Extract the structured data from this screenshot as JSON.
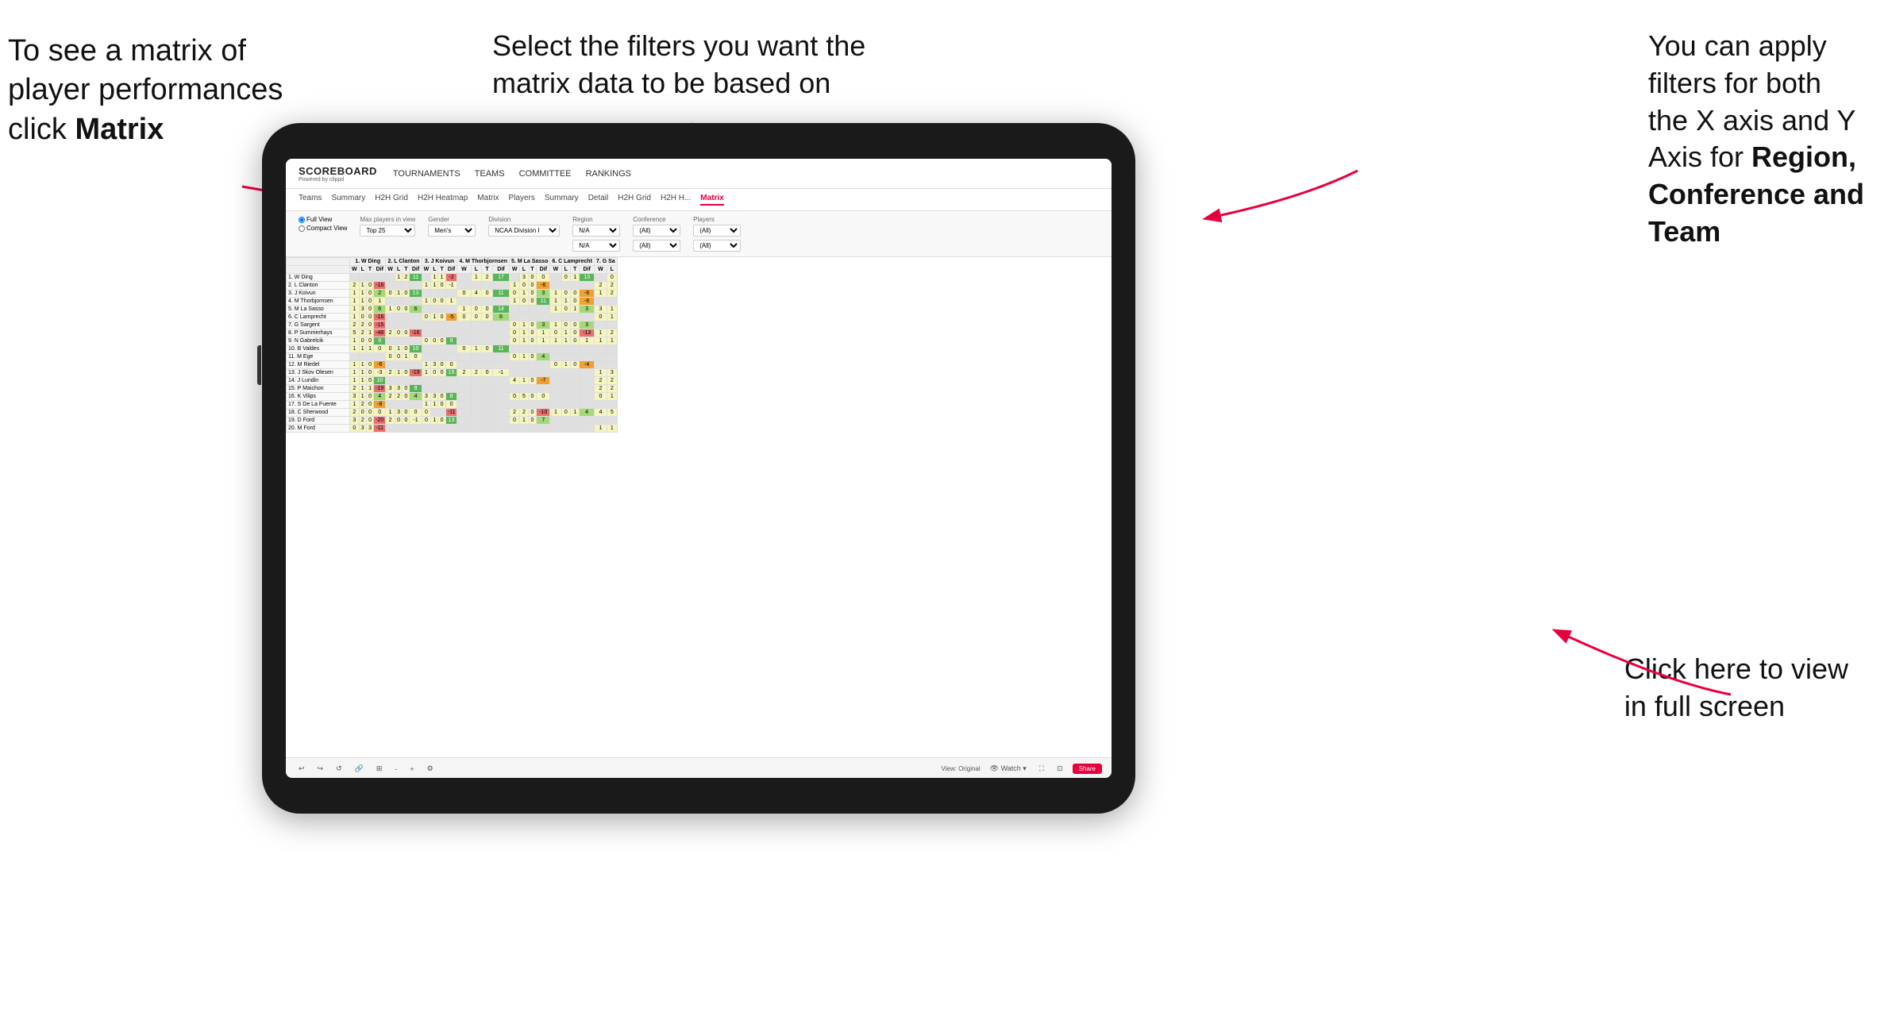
{
  "annotations": {
    "top_left": {
      "line1": "To see a matrix of",
      "line2": "player performances",
      "line3_prefix": "click ",
      "line3_bold": "Matrix"
    },
    "top_center": {
      "line1": "Select the filters you want the",
      "line2": "matrix data to be based on"
    },
    "top_right": {
      "line1": "You  can apply",
      "line2": "filters for both",
      "line3": "the X axis and Y",
      "line4_prefix": "Axis for ",
      "line4_bold": "Region,",
      "line5_bold": "Conference and",
      "line6_bold": "Team"
    },
    "bottom_right": {
      "line1": "Click here to view",
      "line2": "in full screen"
    }
  },
  "nav": {
    "logo": "SCOREBOARD",
    "logo_sub": "Powered by clippd",
    "links": [
      "TOURNAMENTS",
      "TEAMS",
      "COMMITTEE",
      "RANKINGS"
    ]
  },
  "tabs": {
    "items": [
      "Teams",
      "Summary",
      "H2H Grid",
      "H2H Heatmap",
      "Matrix",
      "Players",
      "Summary",
      "Detail",
      "H2H Grid",
      "H2H H...",
      "Matrix"
    ],
    "active": "Matrix"
  },
  "filters": {
    "view_options": [
      "Full View",
      "Compact View"
    ],
    "max_players": "Top 25",
    "gender": "Men's",
    "division": "NCAA Division I",
    "region_label": "Region",
    "region_val": "N/A",
    "conference_label": "Conference",
    "conference_val": "(All)",
    "players_label": "Players",
    "players_val": "(All)"
  },
  "matrix": {
    "col_groups": [
      "1. W Ding",
      "2. L Clanton",
      "3. J Koivun",
      "4. M Thorbjornsen",
      "5. M La Sasso",
      "6. C Lamprecht",
      "7. G Sa"
    ],
    "col_subheaders": [
      "W",
      "L",
      "T",
      "Dif"
    ],
    "rows": [
      {
        "name": "1. W Ding",
        "cells": [
          {
            "type": "gray"
          },
          {
            "val": "1",
            "cls": "yellow"
          },
          {
            "val": "2",
            "cls": "yellow"
          },
          {
            "val": "0",
            "cls": "yellow"
          },
          {
            "val": "11",
            "cls": "green-mid"
          }
        ]
      },
      {
        "name": "2. L Clanton",
        "cells": [
          {
            "val": "2",
            "cls": "green-light"
          },
          {
            "val": "1",
            "cls": "yellow"
          },
          {
            "val": "0",
            "cls": "yellow"
          },
          {
            "val": "-16",
            "cls": "red"
          }
        ]
      },
      {
        "name": "3. J Koivun",
        "cells": [
          {
            "val": "1",
            "cls": "yellow"
          },
          {
            "val": "1",
            "cls": "yellow"
          },
          {
            "val": "0",
            "cls": "yellow"
          },
          {
            "val": "2",
            "cls": "green-light"
          }
        ]
      },
      {
        "name": "4. M Thorbjornsen",
        "cells": [
          {
            "val": "1",
            "cls": "yellow"
          },
          {
            "val": "1",
            "cls": "yellow"
          },
          {
            "val": "0",
            "cls": "yellow"
          },
          {
            "val": "1",
            "cls": "yellow"
          }
        ]
      },
      {
        "name": "5. M La Sasso",
        "cells": [
          {
            "val": "1",
            "cls": "yellow"
          },
          {
            "val": "3",
            "cls": "green-light"
          },
          {
            "val": "0",
            "cls": "yellow"
          },
          {
            "val": "6",
            "cls": "green-light"
          }
        ]
      },
      {
        "name": "6. C Lamprecht",
        "cells": [
          {
            "val": "1",
            "cls": "yellow"
          },
          {
            "val": "0",
            "cls": "yellow"
          },
          {
            "val": "0",
            "cls": "yellow"
          },
          {
            "val": "-16",
            "cls": "red"
          }
        ]
      },
      {
        "name": "7. G Sargent",
        "cells": [
          {
            "val": "2",
            "cls": "green-light"
          },
          {
            "val": "2",
            "cls": "green-light"
          },
          {
            "val": "0",
            "cls": "yellow"
          },
          {
            "val": "-15",
            "cls": "red"
          }
        ]
      },
      {
        "name": "8. P Summerhays",
        "cells": [
          {
            "val": "5",
            "cls": "green-dark"
          },
          {
            "val": "2",
            "cls": "green-light"
          },
          {
            "val": "1",
            "cls": "yellow"
          },
          {
            "val": "-48",
            "cls": "red"
          }
        ]
      },
      {
        "name": "9. N Gabrelcik",
        "cells": [
          {
            "val": "1",
            "cls": "yellow"
          },
          {
            "val": "0",
            "cls": "yellow"
          },
          {
            "val": "0",
            "cls": "yellow"
          },
          {
            "val": "9",
            "cls": "green-mid"
          }
        ]
      },
      {
        "name": "10. B Valdes",
        "cells": [
          {
            "val": "1",
            "cls": "yellow"
          },
          {
            "val": "1",
            "cls": "yellow"
          },
          {
            "val": "1",
            "cls": "yellow"
          },
          {
            "val": "0",
            "cls": "yellow"
          }
        ]
      },
      {
        "name": "11. M Ege",
        "cells": [
          {
            "val": "0",
            "cls": "yellow"
          },
          {
            "val": "0",
            "cls": "yellow"
          },
          {
            "val": "1",
            "cls": "yellow"
          },
          {
            "val": "0",
            "cls": "yellow"
          }
        ]
      },
      {
        "name": "12. M Riedel",
        "cells": [
          {
            "val": "1",
            "cls": "yellow"
          },
          {
            "val": "1",
            "cls": "yellow"
          },
          {
            "val": "0",
            "cls": "yellow"
          },
          {
            "val": "-6",
            "cls": "orange"
          }
        ]
      },
      {
        "name": "13. J Skov Olesen",
        "cells": [
          {
            "val": "1",
            "cls": "yellow"
          },
          {
            "val": "1",
            "cls": "yellow"
          },
          {
            "val": "0",
            "cls": "yellow"
          },
          {
            "val": "-3",
            "cls": "yellow"
          }
        ]
      },
      {
        "name": "14. J Lundin",
        "cells": [
          {
            "val": "1",
            "cls": "yellow"
          },
          {
            "val": "1",
            "cls": "yellow"
          },
          {
            "val": "0",
            "cls": "yellow"
          },
          {
            "val": "10",
            "cls": "green-mid"
          }
        ]
      },
      {
        "name": "15. P Maichon",
        "cells": [
          {
            "val": "2",
            "cls": "green-light"
          },
          {
            "val": "1",
            "cls": "yellow"
          },
          {
            "val": "1",
            "cls": "yellow"
          },
          {
            "val": "-19",
            "cls": "red"
          }
        ]
      },
      {
        "name": "16. K Vilips",
        "cells": [
          {
            "val": "3",
            "cls": "green-light"
          },
          {
            "val": "1",
            "cls": "yellow"
          },
          {
            "val": "0",
            "cls": "yellow"
          },
          {
            "val": "4",
            "cls": "green-light"
          }
        ]
      },
      {
        "name": "17. S De La Fuente",
        "cells": [
          {
            "val": "1",
            "cls": "yellow"
          },
          {
            "val": "2",
            "cls": "green-light"
          },
          {
            "val": "0",
            "cls": "yellow"
          },
          {
            "val": "-8",
            "cls": "orange"
          }
        ]
      },
      {
        "name": "18. C Sherwood",
        "cells": [
          {
            "val": "2",
            "cls": "green-light"
          },
          {
            "val": "0",
            "cls": "yellow"
          },
          {
            "val": "0",
            "cls": "yellow"
          },
          {
            "val": "0",
            "cls": "yellow"
          }
        ]
      },
      {
        "name": "19. D Ford",
        "cells": [
          {
            "val": "3",
            "cls": "green-light"
          },
          {
            "val": "2",
            "cls": "green-light"
          },
          {
            "val": "0",
            "cls": "yellow"
          },
          {
            "val": "-20",
            "cls": "red"
          }
        ]
      },
      {
        "name": "20. M Ford",
        "cells": [
          {
            "val": "0",
            "cls": "yellow"
          },
          {
            "val": "3",
            "cls": "green-light"
          },
          {
            "val": "3",
            "cls": "green-light"
          },
          {
            "val": "1",
            "cls": "yellow"
          },
          {
            "val": "-11",
            "cls": "red"
          }
        ]
      }
    ]
  },
  "toolbar": {
    "view_label": "View: Original",
    "watch_label": "Watch",
    "share_label": "Share"
  }
}
